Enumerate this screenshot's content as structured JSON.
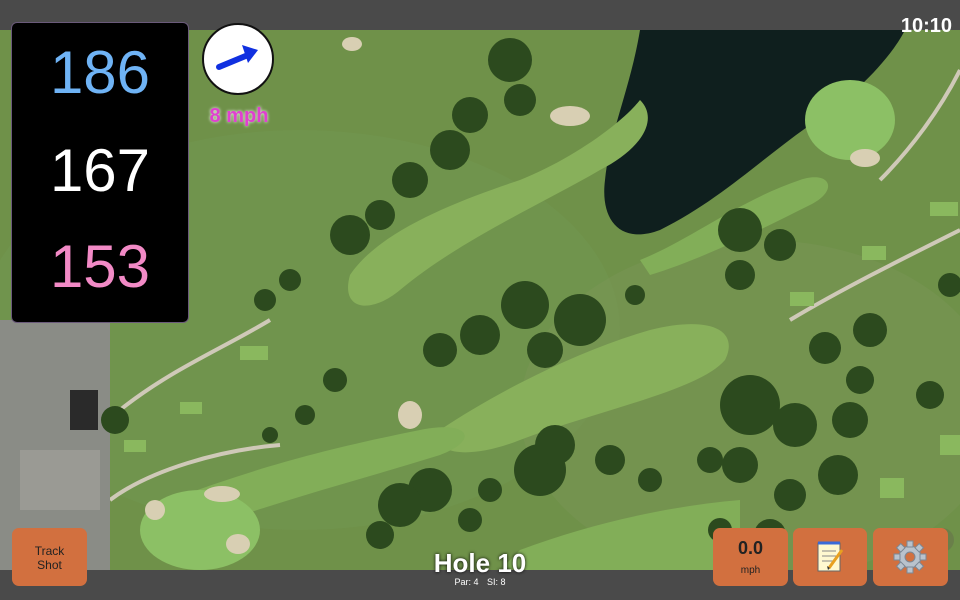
{
  "status_bar": {
    "time": "10:10"
  },
  "distances": {
    "back": "186",
    "middle": "167",
    "front": "153"
  },
  "wind": {
    "speed": "8 mph",
    "icon": "wind-arrow-icon"
  },
  "hole": {
    "title": "Hole 10",
    "par": "Par: 4",
    "si": "SI: 8"
  },
  "buttons": {
    "track_shot_line1": "Track",
    "track_shot_line2": "Shot",
    "speed_value": "0.0",
    "speed_unit": "mph",
    "notes_icon": "notepad-icon",
    "settings_icon": "gear-icon"
  },
  "colors": {
    "back": "#6fb3f5",
    "middle": "#ffffff",
    "front": "#f28ac6",
    "wind_text": "#e040d0",
    "button_bg": "#d2703f"
  }
}
